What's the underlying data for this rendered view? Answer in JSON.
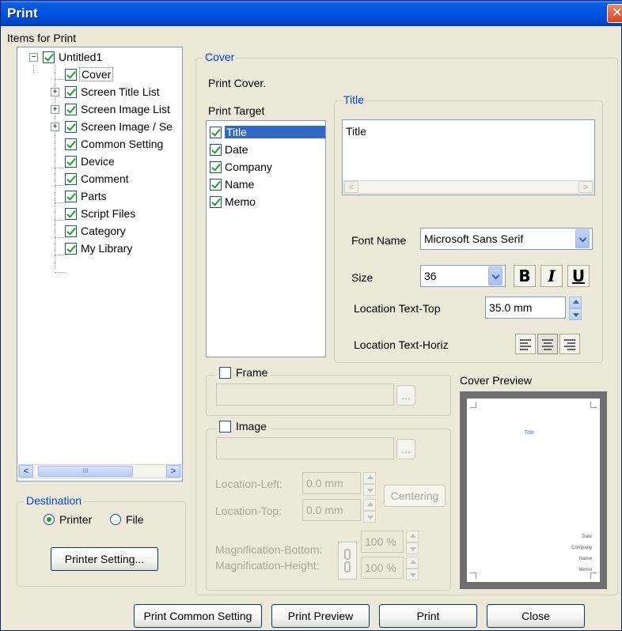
{
  "window": {
    "title": "Print",
    "close_glyph": "✕"
  },
  "items_for_print": {
    "label": "Items for Print",
    "tree": [
      {
        "label": "Untitled1",
        "checked": true,
        "expander": "minus"
      },
      {
        "label": "Cover",
        "checked": true,
        "selected": true
      },
      {
        "label": "Screen Title List",
        "checked": true,
        "expander": "plus"
      },
      {
        "label": "Screen Image List",
        "checked": true,
        "expander": "plus"
      },
      {
        "label": "Screen Image / Se",
        "checked": true,
        "expander": "plus"
      },
      {
        "label": "Common Setting",
        "checked": true
      },
      {
        "label": "Device",
        "checked": true
      },
      {
        "label": "Comment",
        "checked": true
      },
      {
        "label": "Parts",
        "checked": true
      },
      {
        "label": "Script Files",
        "checked": true
      },
      {
        "label": "Category",
        "checked": true
      },
      {
        "label": "My Library",
        "checked": true
      }
    ],
    "scroll_left": "<",
    "scroll_right": ">",
    "scroll_thumb_grip": "III"
  },
  "destination": {
    "label": "Destination",
    "options": [
      {
        "label": "Printer",
        "selected": true
      },
      {
        "label": "File",
        "selected": false
      }
    ],
    "printer_setting_button": "Printer Setting..."
  },
  "cover": {
    "legend": "Cover",
    "print_cover_label": "Print Cover.",
    "print_target_label": "Print Target",
    "print_targets": [
      {
        "label": "Title",
        "checked": true,
        "selected": true
      },
      {
        "label": "Date",
        "checked": true
      },
      {
        "label": "Company",
        "checked": true
      },
      {
        "label": "Name",
        "checked": true
      },
      {
        "label": "Memo",
        "checked": true
      }
    ],
    "title_group": {
      "legend": "Title",
      "text_value": "Title",
      "scroll_left": "<",
      "scroll_right": ">",
      "font_name_label": "Font Name",
      "font_name_value": "Microsoft Sans Serif",
      "size_label": "Size",
      "size_value": "36",
      "bold_glyph": "B",
      "italic_glyph": "I",
      "underline_glyph": "U",
      "location_top_label": "Location Text-Top",
      "location_top_value": "35.0 mm",
      "location_horiz_label": "Location Text-Horiz",
      "horiz_alignment": "center"
    },
    "frame": {
      "label": "Frame",
      "checked": false,
      "browse": "..."
    },
    "image": {
      "label": "Image",
      "checked": false,
      "browse": "...",
      "location_left_label": "Location-Left:",
      "location_left_value": "0.0 mm",
      "location_top_label": "Location-Top:",
      "location_top_value": "0.0 mm",
      "centering_button": "Centering",
      "mag_bottom_label": "Magnification-Bottom:",
      "mag_bottom_value": "100 %",
      "mag_height_label": "Magnification-Height:",
      "mag_height_value": "100 %"
    },
    "preview": {
      "label": "Cover Preview",
      "title_text": "Title",
      "lines": [
        "Date",
        "Company",
        "Name",
        "Memo"
      ]
    }
  },
  "footer": {
    "print_common_setting": "Print Common Setting",
    "print_preview": "Print Preview",
    "print": "Print",
    "close": "Close"
  },
  "colors": {
    "titlebar": "#0054e3",
    "dialog_bg": "#ece9d8",
    "selection": "#316ac5",
    "legend_blue": "#0046d5",
    "check_green": "#21a121"
  }
}
